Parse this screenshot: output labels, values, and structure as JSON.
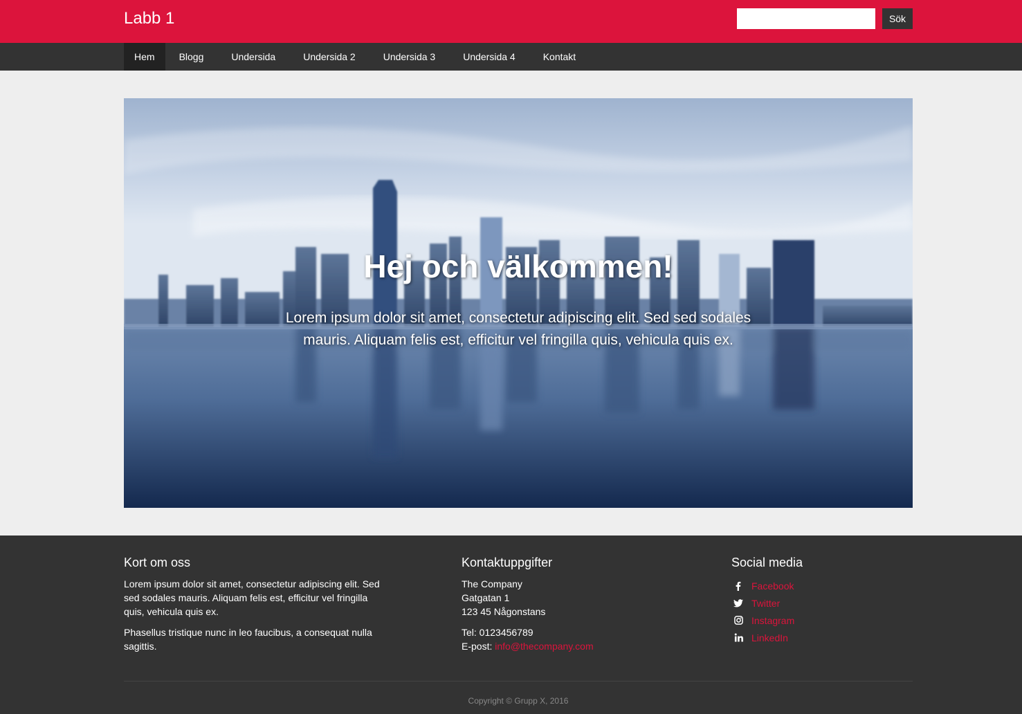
{
  "header": {
    "site_title": "Labb 1",
    "search_placeholder": "",
    "search_button": "Sök"
  },
  "nav": {
    "items": [
      {
        "label": "Hem",
        "active": true
      },
      {
        "label": "Blogg"
      },
      {
        "label": "Undersida"
      },
      {
        "label": "Undersida 2"
      },
      {
        "label": "Undersida 3"
      },
      {
        "label": "Undersida 4"
      },
      {
        "label": "Kontakt"
      }
    ]
  },
  "hero": {
    "title": "Hej och välkommen!",
    "text": "Lorem ipsum dolor sit amet, consectetur adipiscing elit. Sed sed sodales mauris. Aliquam felis est, efficitur vel fringilla quis, vehicula quis ex."
  },
  "footer": {
    "about": {
      "heading": "Kort om oss",
      "p1": "Lorem ipsum dolor sit amet, consectetur adipiscing elit. Sed sed sodales mauris. Aliquam felis est, efficitur vel fringilla quis, vehicula quis ex.",
      "p2": "Phasellus tristique nunc in leo faucibus, a consequat nulla sagittis."
    },
    "contact": {
      "heading": "Kontaktuppgifter",
      "company": "The Company",
      "street": "Gatgatan 1",
      "city": "123 45 Någonstans",
      "phone": "Tel: 0123456789",
      "email_label": "E-post: ",
      "email": "info@thecompany.com"
    },
    "social": {
      "heading": "Social media",
      "items": [
        {
          "label": "Facebook",
          "icon": "facebook-icon"
        },
        {
          "label": "Twitter",
          "icon": "twitter-icon"
        },
        {
          "label": "Instagram",
          "icon": "instagram-icon"
        },
        {
          "label": "LinkedIn",
          "icon": "linkedin-icon"
        }
      ]
    },
    "copyright": "Copyright © Grupp X, 2016"
  },
  "colors": {
    "brand": "#dc143c",
    "dark": "#333333",
    "background": "#eeeeee"
  }
}
